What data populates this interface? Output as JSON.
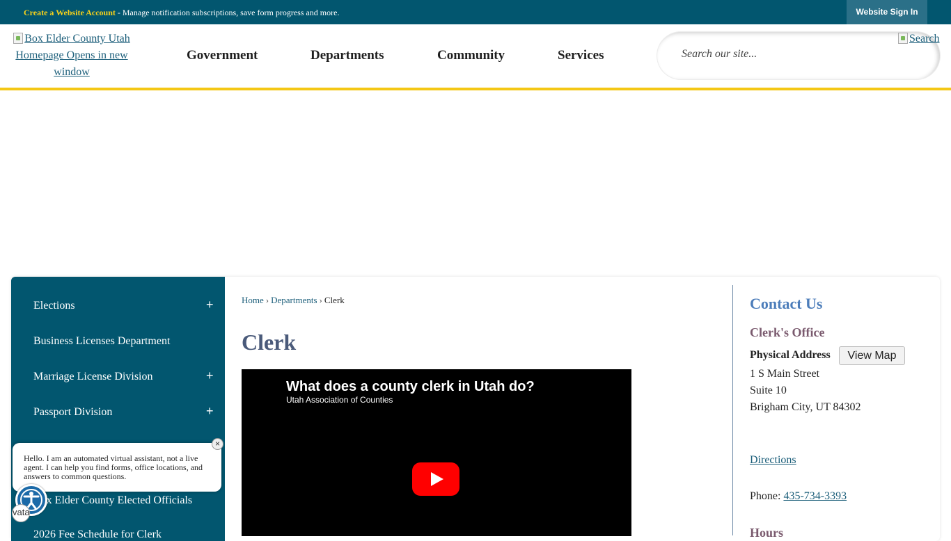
{
  "topbar": {
    "account_link": "Create a Website Account",
    "account_text": " - Manage notification subscriptions, save form progress and more.",
    "signin_label": "Website Sign In"
  },
  "header": {
    "logo_alt": "Box Elder County Utah Homepage Opens in new window",
    "nav": [
      "Government",
      "Departments",
      "Community",
      "Services"
    ],
    "search_placeholder": "Search our site...",
    "search_alt": "Search"
  },
  "sidebar": {
    "items": [
      {
        "label": "Elections",
        "expandable": true
      },
      {
        "label": "Business Licenses Department",
        "expandable": false
      },
      {
        "label": "Marriage License Division",
        "expandable": true
      },
      {
        "label": "Passport Division",
        "expandable": true
      },
      {
        "label": "Box Elder County Elected Officials",
        "expandable": false
      },
      {
        "label": "2026 Fee Schedule for Clerk",
        "expandable": false
      }
    ],
    "expand_icon": "+"
  },
  "breadcrumb": {
    "items": [
      "Home",
      "Departments",
      "Clerk"
    ],
    "separator": "›"
  },
  "page": {
    "title": "Clerk"
  },
  "video": {
    "title": "What does a county clerk in Utah do?",
    "channel": "Utah Association of Counties"
  },
  "contact": {
    "heading": "Contact Us",
    "office": "Clerk's Office",
    "address_label": "Physical Address",
    "map_button": "View Map",
    "address_lines": [
      "1 S Main Street",
      "Suite 10",
      "Brigham City, UT 84302"
    ],
    "directions": "Directions",
    "phone_label": "Phone: ",
    "phone": "435-734-3393",
    "hours_label": "Hours"
  },
  "chat": {
    "message": "Hello. I am an automated virtual assistant, not a live agent. I can help you find forms, office locations, and answers to common questions.",
    "close": "×"
  },
  "widget": {
    "avatar_text": "vata"
  },
  "colors": {
    "primary": "#02566f",
    "accent": "#f4c715",
    "link": "#1b5e7a",
    "title": "#4a5a7a",
    "contact_heading": "#4c7dba",
    "office_heading": "#7a5a6e"
  },
  "icons": [
    "broken-image-icon",
    "plus-icon",
    "close-icon",
    "accessibility-icon",
    "play-icon"
  ]
}
